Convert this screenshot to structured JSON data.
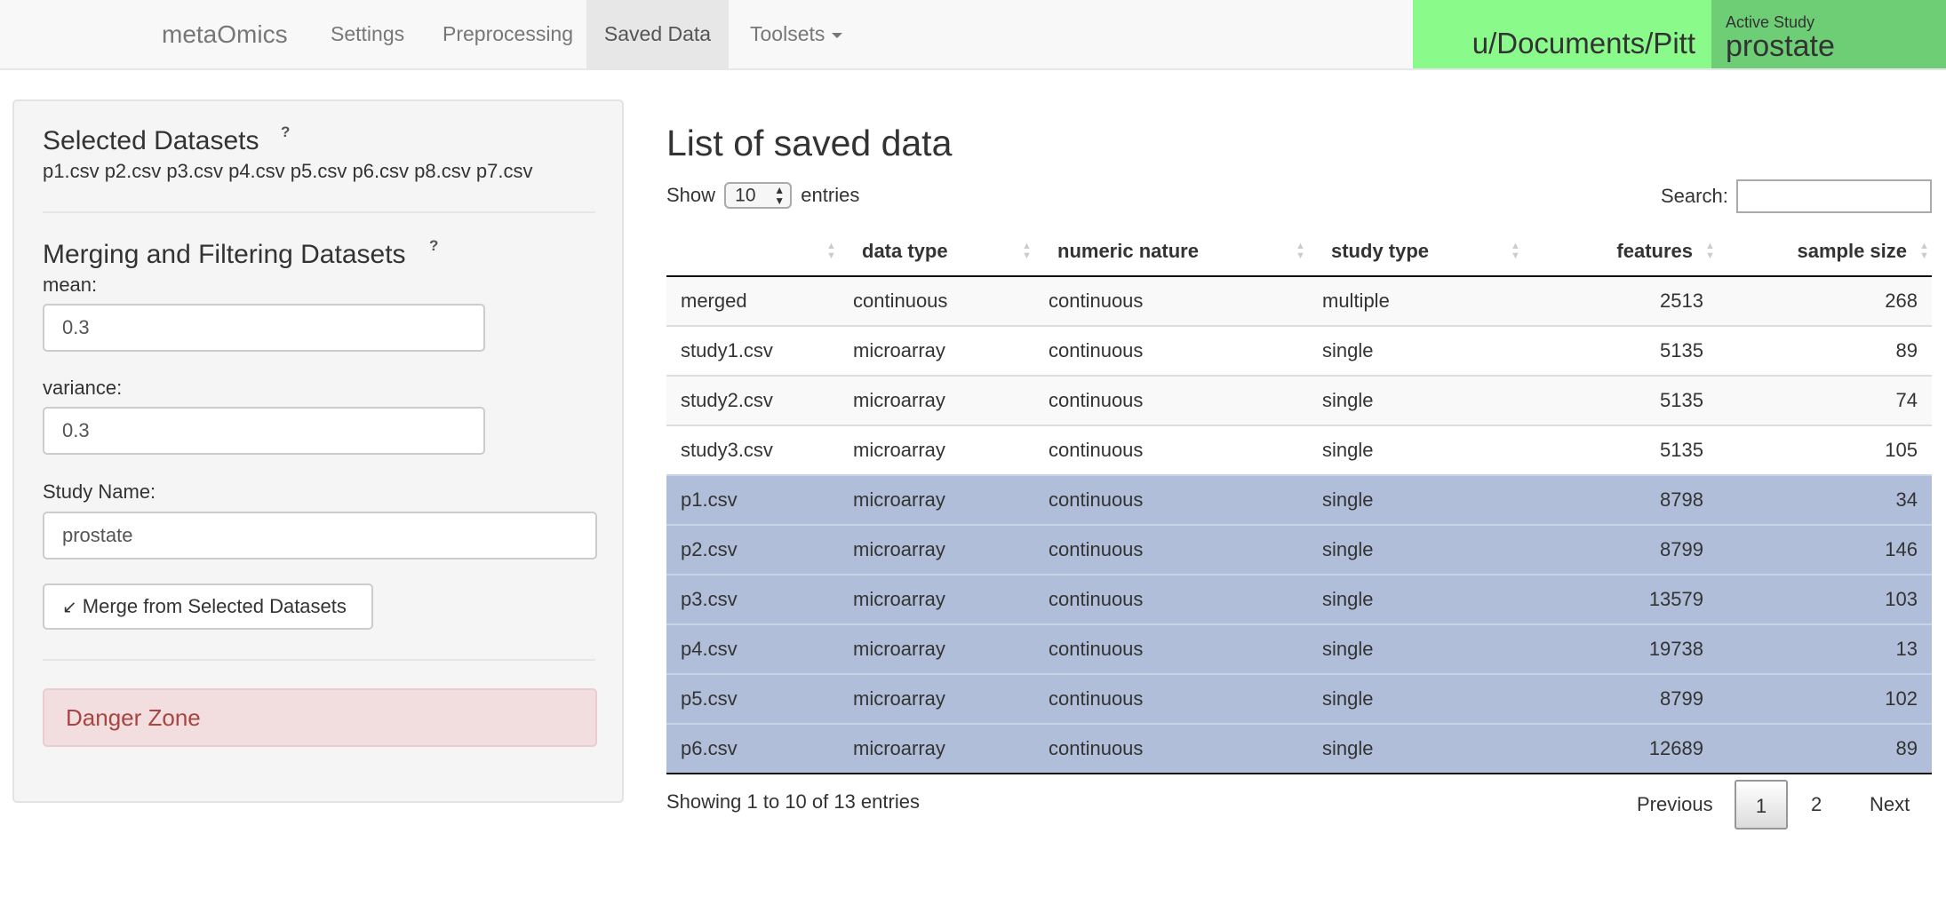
{
  "navbar": {
    "brand": "metaOmics",
    "items": [
      {
        "label": "Settings"
      },
      {
        "label": "Preprocessing"
      },
      {
        "label": "Saved Data"
      },
      {
        "label": "Toolsets"
      }
    ],
    "path": "u/Documents/Pitt",
    "active_study_label": "Active Study",
    "active_study": "prostate"
  },
  "sidebar": {
    "selected_title": "Selected Datasets",
    "selected_help": "?",
    "selected_list": "p1.csv p2.csv p3.csv p4.csv p5.csv p6.csv p8.csv p7.csv",
    "merge_title": "Merging and Filtering Datasets",
    "merge_help": "?",
    "mean_label": "mean:",
    "mean_value": "0.3",
    "variance_label": "variance:",
    "variance_value": "0.3",
    "study_name_label": "Study Name:",
    "study_name_value": "prostate",
    "merge_button": "Merge from Selected Datasets",
    "danger_zone": "Danger Zone"
  },
  "main": {
    "title": "List of saved data",
    "show_label": "Show",
    "entries_value": "10",
    "entries_label": "entries",
    "search_label": "Search:",
    "columns": [
      "",
      "data type",
      "numeric nature",
      "study type",
      "features",
      "sample size"
    ],
    "rows": [
      {
        "name": "merged",
        "data_type": "continuous",
        "numeric_nature": "continuous",
        "study_type": "multiple",
        "features": "2513",
        "sample_size": "268",
        "selected": false
      },
      {
        "name": "study1.csv",
        "data_type": "microarray",
        "numeric_nature": "continuous",
        "study_type": "single",
        "features": "5135",
        "sample_size": "89",
        "selected": false
      },
      {
        "name": "study2.csv",
        "data_type": "microarray",
        "numeric_nature": "continuous",
        "study_type": "single",
        "features": "5135",
        "sample_size": "74",
        "selected": false
      },
      {
        "name": "study3.csv",
        "data_type": "microarray",
        "numeric_nature": "continuous",
        "study_type": "single",
        "features": "5135",
        "sample_size": "105",
        "selected": false
      },
      {
        "name": "p1.csv",
        "data_type": "microarray",
        "numeric_nature": "continuous",
        "study_type": "single",
        "features": "8798",
        "sample_size": "34",
        "selected": true
      },
      {
        "name": "p2.csv",
        "data_type": "microarray",
        "numeric_nature": "continuous",
        "study_type": "single",
        "features": "8799",
        "sample_size": "146",
        "selected": true
      },
      {
        "name": "p3.csv",
        "data_type": "microarray",
        "numeric_nature": "continuous",
        "study_type": "single",
        "features": "13579",
        "sample_size": "103",
        "selected": true
      },
      {
        "name": "p4.csv",
        "data_type": "microarray",
        "numeric_nature": "continuous",
        "study_type": "single",
        "features": "19738",
        "sample_size": "13",
        "selected": true
      },
      {
        "name": "p5.csv",
        "data_type": "microarray",
        "numeric_nature": "continuous",
        "study_type": "single",
        "features": "8799",
        "sample_size": "102",
        "selected": true
      },
      {
        "name": "p6.csv",
        "data_type": "microarray",
        "numeric_nature": "continuous",
        "study_type": "single",
        "features": "12689",
        "sample_size": "89",
        "selected": true
      }
    ],
    "info": "Showing 1 to 10 of 13 entries",
    "pagination": {
      "previous": "Previous",
      "page1": "1",
      "page2": "2",
      "next": "Next"
    }
  },
  "colors": {
    "path_bg": "#8afa8a",
    "study_bg": "#6ece76",
    "selected_row": "#b0bed9",
    "danger_bg": "#f2dede",
    "danger_text": "#a94442"
  }
}
